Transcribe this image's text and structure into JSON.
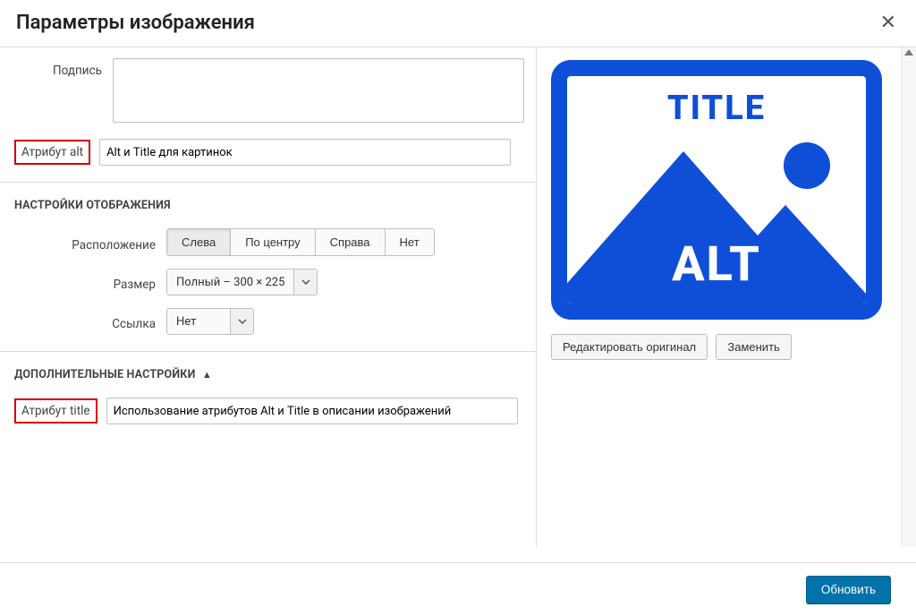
{
  "header": {
    "title": "Параметры изображения"
  },
  "fields": {
    "caption_label": "Подпись",
    "caption_value": "",
    "alt_label": "Атрибут alt",
    "alt_value": "Alt и Title для картинок",
    "title_label": "Атрибут title",
    "title_value": "Использование атрибутов Alt и Title в описании изображений"
  },
  "display_settings": {
    "heading": "НАСТРОЙКИ ОТОБРАЖЕНИЯ",
    "align_label": "Расположение",
    "align_options": {
      "left": "Слева",
      "center": "По центру",
      "right": "Справа",
      "none": "Нет"
    },
    "size_label": "Размер",
    "size_value": "Полный – 300 × 225",
    "link_label": "Ссылка",
    "link_value": "Нет"
  },
  "advanced": {
    "heading": "ДОПОЛНИТЕЛЬНЫЕ НАСТРОЙКИ"
  },
  "preview": {
    "title_word": "TITLE",
    "alt_word": "ALT",
    "edit_original": "Редактировать оригинал",
    "replace": "Заменить"
  },
  "footer": {
    "update": "Обновить"
  }
}
